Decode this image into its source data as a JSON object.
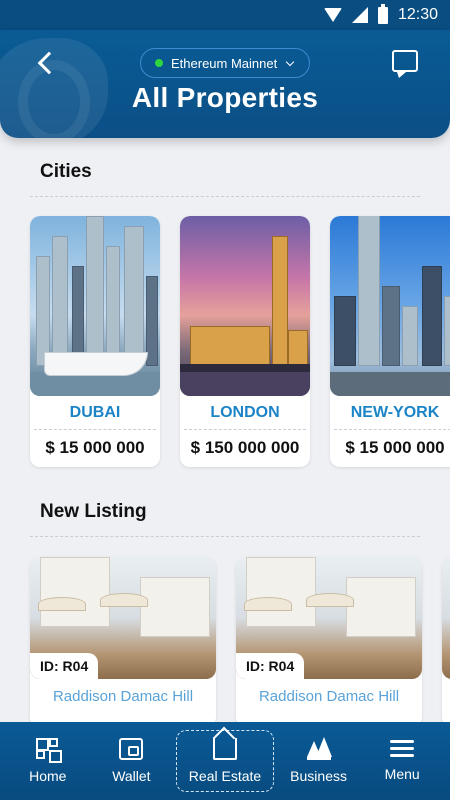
{
  "status_bar": {
    "time": "12:30"
  },
  "header": {
    "network": "Ethereum Mainnet",
    "title": "All Properties"
  },
  "sections": {
    "cities": "Cities",
    "new_listing": "New Listing"
  },
  "cities": [
    {
      "name": "DUBAI",
      "price": "$ 15 000 000"
    },
    {
      "name": "LONDON",
      "price": "$ 150 000 000"
    },
    {
      "name": "NEW-YORK",
      "price": "$ 15 000 000"
    }
  ],
  "listings": [
    {
      "id": "ID: R04",
      "name": "Raddison Damac Hill"
    },
    {
      "id": "ID: R04",
      "name": "Raddison Damac Hill"
    }
  ],
  "bottom_nav": [
    {
      "label": "Home",
      "icon": "home-grid-icon"
    },
    {
      "label": "Wallet",
      "icon": "wallet-icon"
    },
    {
      "label": "Real Estate",
      "icon": "real-estate-icon",
      "active": true
    },
    {
      "label": "Business",
      "icon": "business-chart-icon"
    },
    {
      "label": "Menu",
      "icon": "hamburger-menu-icon"
    }
  ],
  "colors": {
    "header_bg": "#0b4f86",
    "accent_blue": "#1b84c6",
    "network_dot": "#2ed63f",
    "page_bg": "#eef0f4"
  }
}
